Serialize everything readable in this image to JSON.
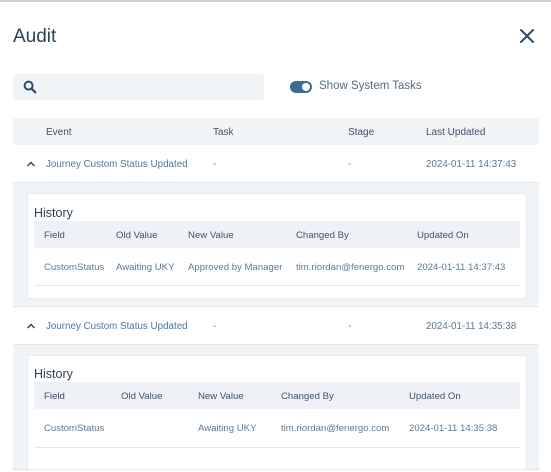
{
  "dialog": {
    "title": "Audit",
    "close_icon": "close-icon"
  },
  "search": {
    "placeholder": "",
    "icon": "search-icon"
  },
  "toggle": {
    "label": "Show System Tasks",
    "on": true,
    "color": "#3e6b96"
  },
  "table": {
    "columns": [
      "Event",
      "Task",
      "Stage",
      "Last Updated"
    ],
    "rows": [
      {
        "event": "Journey Custom Status Updated",
        "task": "-",
        "stage": "-",
        "last_updated": "2024-01-11 14:37:43",
        "expanded": true,
        "history": {
          "title": "History",
          "columns": [
            "Field",
            "Old Value",
            "New Value",
            "Changed By",
            "Updated On"
          ],
          "rows": [
            {
              "field": "CustomStatus",
              "old_value": "Awaiting UKY",
              "new_value": "Approved by Manager",
              "changed_by": "tim.riordan@fenergo.com",
              "updated_on": "2024-01-11 14:37:43"
            }
          ]
        }
      },
      {
        "event": "Journey Custom Status Updated",
        "task": "-",
        "stage": "-",
        "last_updated": "2024-01-11 14:35:38",
        "expanded": true,
        "history": {
          "title": "History",
          "columns": [
            "Field",
            "Old Value",
            "New Value",
            "Changed By",
            "Updated On"
          ],
          "rows": [
            {
              "field": "CustomStatus",
              "old_value": "",
              "new_value": "Awaiting UKY",
              "changed_by": "tim.riordan@fenergo.com",
              "updated_on": "2024-01-11 14:35:38"
            }
          ]
        }
      }
    ]
  },
  "colors": {
    "link": "#4a78a6",
    "text": "#5a7a99",
    "header_bg": "#f1f4f7",
    "title": "#2d4155"
  }
}
